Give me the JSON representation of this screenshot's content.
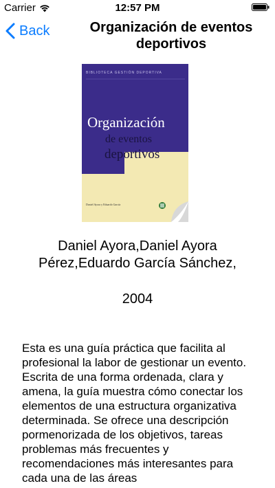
{
  "status_bar": {
    "carrier": "Carrier",
    "time": "12:57 PM"
  },
  "nav": {
    "back_label": "Back",
    "title_line1": "Organización de eventos",
    "title_line2": "deportivos"
  },
  "book": {
    "cover_series": "BIBLIOTECA GESTIÓN DEPORTIVA",
    "cover_title_line1": "Organización",
    "cover_title_line2": "de eventos",
    "cover_title_line3": "deportivos",
    "cover_authors": "Daniel Ayora y Eduardo García",
    "authors_line1": "Daniel Ayora,Daniel Ayora",
    "authors_line2": "Pérez,Eduardo García Sánchez,",
    "year": "2004",
    "description": "Esta es una guía práctica que facilita al profesional la labor de gestionar un evento. Escrita de una forma ordenada, clara y amena, la guía muestra cómo conectar los elementos de una estructura organizativa determinada. Se ofrece una descripción pormenorizada de los objetivos, tareas problemas más frecuentes y recomendaciones más interesantes para cada una de las áreas"
  },
  "colors": {
    "accent": "#0a7cff",
    "cover_purple": "#3b2c8a",
    "cover_cream": "#f3e9b3"
  }
}
